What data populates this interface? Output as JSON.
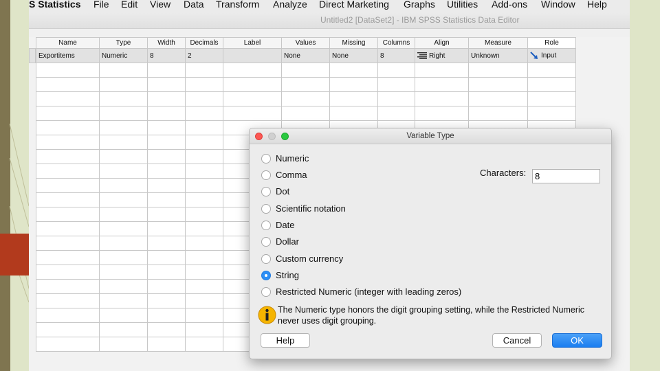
{
  "menubar": {
    "app_name": "S Statistics",
    "items": [
      "File",
      "Edit",
      "View",
      "Data",
      "Transform",
      "Analyze",
      "Direct Marketing",
      "Graphs",
      "Utilities",
      "Add-ons",
      "Window",
      "Help"
    ]
  },
  "window": {
    "title": "Untitled2 [DataSet2] - IBM SPSS Statistics Data Editor"
  },
  "grid": {
    "headers": [
      "Name",
      "Type",
      "Width",
      "Decimals",
      "Label",
      "Values",
      "Missing",
      "Columns",
      "Align",
      "Measure",
      "Role"
    ],
    "row": [
      "Exportitems",
      "Numeric",
      "8",
      "2",
      "",
      "None",
      "None",
      "8",
      "Right",
      "Unknown",
      "Input"
    ],
    "align_icon": "align-right-icon",
    "role_icon": "input-arrow-icon"
  },
  "dialog": {
    "title": "Variable Type",
    "options": [
      {
        "label": "Numeric",
        "checked": false
      },
      {
        "label": "Comma",
        "checked": false
      },
      {
        "label": "Dot",
        "checked": false
      },
      {
        "label": "Scientific notation",
        "checked": false
      },
      {
        "label": "Date",
        "checked": false
      },
      {
        "label": "Dollar",
        "checked": false
      },
      {
        "label": "Custom currency",
        "checked": false
      },
      {
        "label": "String",
        "checked": true
      },
      {
        "label": "Restricted Numeric (integer with leading zeros)",
        "checked": false
      }
    ],
    "characters_label": "Characters:",
    "characters_value": "8",
    "info_text": "The Numeric type honors the digit grouping setting, while the Restricted Numeric never uses digit grouping.",
    "buttons": {
      "help": "Help",
      "cancel": "Cancel",
      "ok": "OK"
    },
    "info_icon": "info-icon"
  },
  "colors": {
    "accent": "#2d8ff5",
    "ok_button": "#1b7ef0",
    "slide_red": "#b23a1d",
    "slide_olive": "#7f7550"
  }
}
